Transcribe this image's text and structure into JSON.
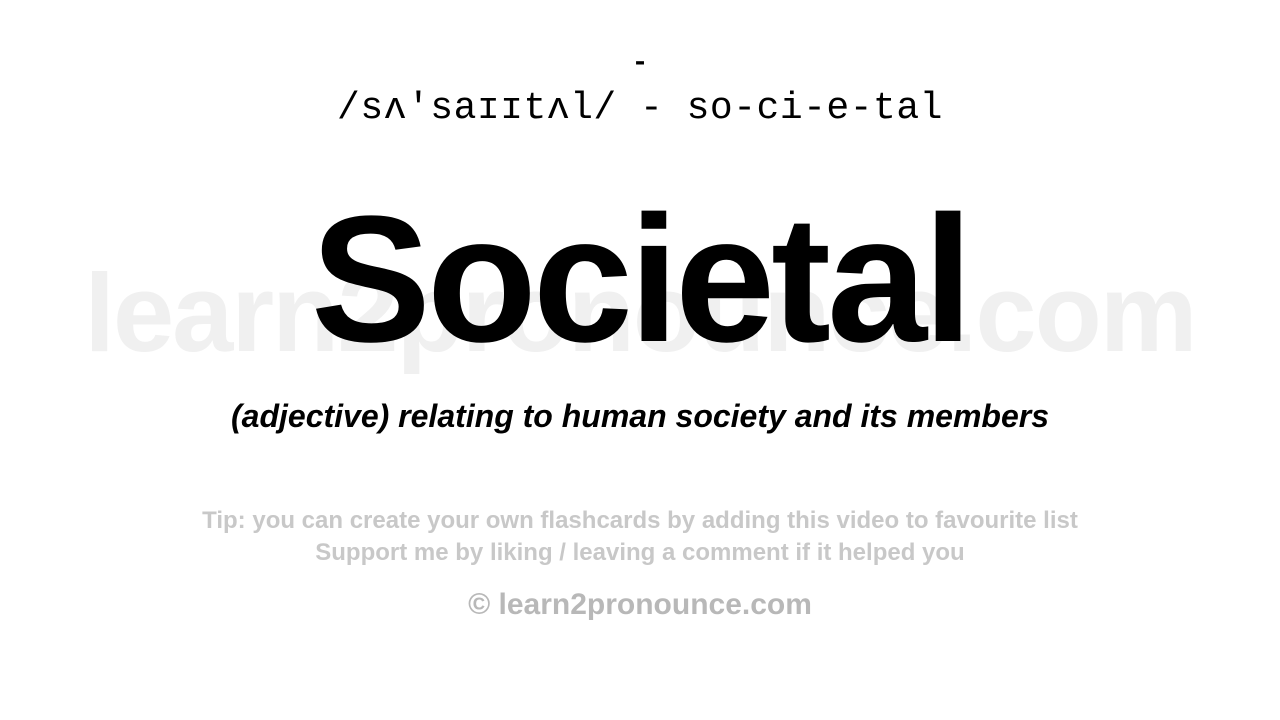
{
  "watermark": "learn2pronounce.com",
  "dash": "-",
  "ipa": "/sʌ'saɪɪtʌl/ - so-ci-e-tal",
  "word": "Societal",
  "definition": "(adjective) relating to human society and its members",
  "tip_line1": "Tip: you can create your own flashcards by adding this video to favourite list",
  "tip_line2": "Support me by liking / leaving a comment if it helped you",
  "copyright": "© learn2pronounce.com"
}
